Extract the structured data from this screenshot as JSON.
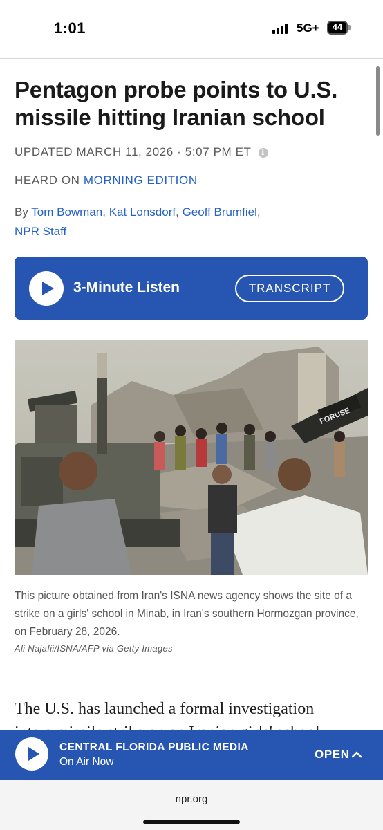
{
  "status_bar": {
    "time": "1:01",
    "network": "5G+",
    "battery": "44"
  },
  "article": {
    "headline": "Pentagon probe points to U.S. missile hitting Iranian school",
    "updated": "UPDATED MARCH 11, 2026 · 5:07 PM ET",
    "heard_on_prefix": "HEARD ON",
    "heard_on_program": "MORNING EDITION",
    "byline_prefix": "By",
    "authors": [
      "Tom Bowman",
      "Kat Lonsdorf",
      "Geoff Brumfiel",
      "NPR Staff"
    ],
    "listen_label": "3-Minute Listen",
    "transcript_label": "TRANSCRIPT",
    "photo_caption": "This picture obtained from Iran's ISNA news agency shows the site of a strike on a girls' school in Minab, in Iran's southern Hormozgan province, on February 28, 2026.",
    "photo_credit": "Ali Najafii/ISNA/AFP via Getty Images",
    "photo_sign": "FORUSE",
    "body_lines": [
      "The U.S. has launched a formal investigation",
      "into a missile strike on an Iranian girls' school"
    ]
  },
  "player": {
    "station": "CENTRAL FLORIDA PUBLIC MEDIA",
    "status": "On Air Now",
    "open_label": "OPEN"
  },
  "browser": {
    "url": "npr.org"
  },
  "colors": {
    "npr_blue": "#2656b1",
    "link_blue": "#2360c8"
  }
}
